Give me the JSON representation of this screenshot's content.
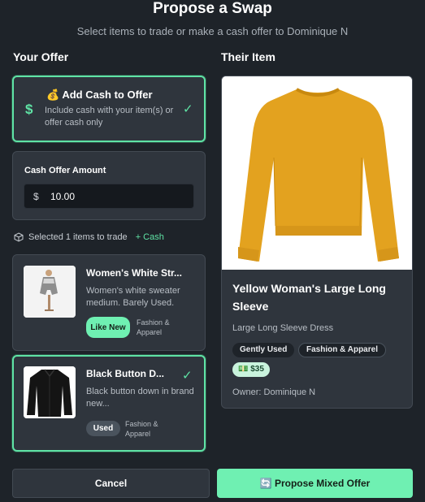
{
  "header": {
    "title": "Propose a Swap",
    "subtitle": "Select items to trade or make a cash offer to Dominique N"
  },
  "your_offer": {
    "heading": "Your Offer",
    "cash_toggle": {
      "icon": "money-bag-icon",
      "title": "💰 Add Cash to Offer",
      "description": "Include cash with your item(s) or offer cash only",
      "checked": true
    },
    "cash_amount": {
      "label": "Cash Offer Amount",
      "currency": "$",
      "value": "10.00"
    },
    "summary": {
      "icon": "package-icon",
      "text": "Selected 1 items to trade",
      "cash": "+ Cash"
    },
    "items": [
      {
        "name": "Women's White Str...",
        "description": "Women's white sweater medium. Barely Used.",
        "condition": "Like New",
        "category": "Fashion & Apparel",
        "selected": false,
        "condition_color": "#6ff0b2"
      },
      {
        "name": "Black Button D...",
        "description": "Black button down in brand new...",
        "condition": "Used",
        "category": "Fashion & Apparel",
        "selected": true,
        "condition_color": "#4a535d"
      }
    ]
  },
  "their_item": {
    "heading": "Their Item",
    "name": "Yellow Woman's Large Long Sleeve",
    "description": "Large Long Sleeve Dress",
    "condition": "Gently Used",
    "category": "Fashion & Apparel",
    "price": "💵 $35",
    "owner": "Owner: Dominique N"
  },
  "footer": {
    "cancel_label": "Cancel",
    "propose_label": "🔄 Propose Mixed Offer"
  },
  "colors": {
    "accent": "#5fe3a5",
    "background": "#1e2329",
    "panel": "#2f353d"
  }
}
